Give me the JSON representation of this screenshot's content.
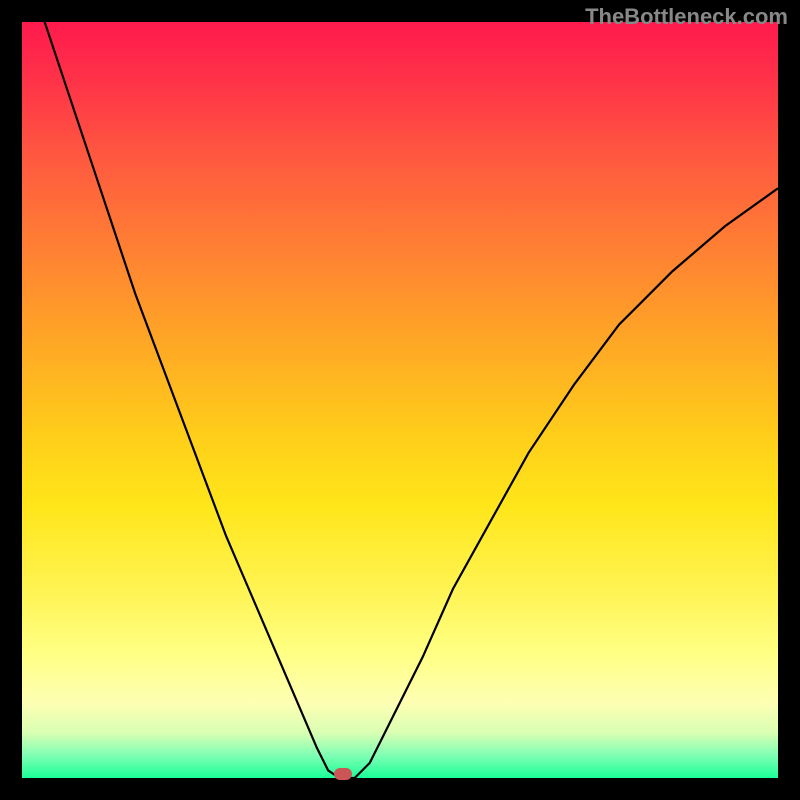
{
  "watermark": "TheBottleneck.com",
  "chart_data": {
    "type": "line",
    "title": "",
    "xlabel": "",
    "ylabel": "",
    "xlim": [
      0,
      100
    ],
    "ylim": [
      0,
      100
    ],
    "series": [
      {
        "name": "curve",
        "x": [
          3,
          6,
          9,
          12,
          15,
          18,
          21,
          24,
          27,
          30,
          33,
          36,
          39,
          40.5,
          42,
          44,
          46,
          49,
          53,
          57,
          62,
          67,
          73,
          79,
          86,
          93,
          100
        ],
        "values": [
          100,
          91,
          82,
          73,
          64,
          56,
          48,
          40,
          32,
          25,
          18,
          11,
          4,
          1,
          0,
          0,
          2,
          8,
          16,
          25,
          34,
          43,
          52,
          60,
          67,
          73,
          78
        ]
      }
    ],
    "marker": {
      "x": 42.5,
      "y": 0.5
    },
    "gradient": {
      "top_color": "#ff1a4d",
      "mid_color": "#ffe61a",
      "bottom_color": "#1aff99"
    }
  }
}
